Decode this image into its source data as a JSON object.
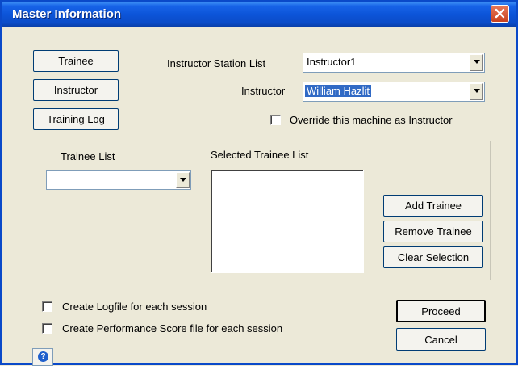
{
  "window": {
    "title": "Master Information"
  },
  "buttons": {
    "trainee": "Trainee",
    "instructor": "Instructor",
    "training_log": "Training Log",
    "add_trainee": "Add Trainee",
    "remove_trainee": "Remove Trainee",
    "clear_selection": "Clear Selection",
    "proceed": "Proceed",
    "cancel": "Cancel"
  },
  "instructor_station": {
    "label": "Instructor Station List",
    "value": "Instructor1"
  },
  "instructor_select": {
    "label": "Instructor",
    "value": "William Hazlit"
  },
  "override_checkbox": {
    "label": "Override this machine as Instructor",
    "checked": false
  },
  "trainee_list": {
    "label": "Trainee List",
    "value": ""
  },
  "selected_trainee_list": {
    "label": "Selected Trainee List",
    "items": []
  },
  "options": {
    "logfile": {
      "label": "Create Logfile for each session",
      "checked": false
    },
    "performance": {
      "label": "Create Performance Score file for each session",
      "checked": false
    }
  },
  "icons": {
    "close": "close-icon",
    "help": "help-icon",
    "dropdown": "chevron-down-icon"
  }
}
